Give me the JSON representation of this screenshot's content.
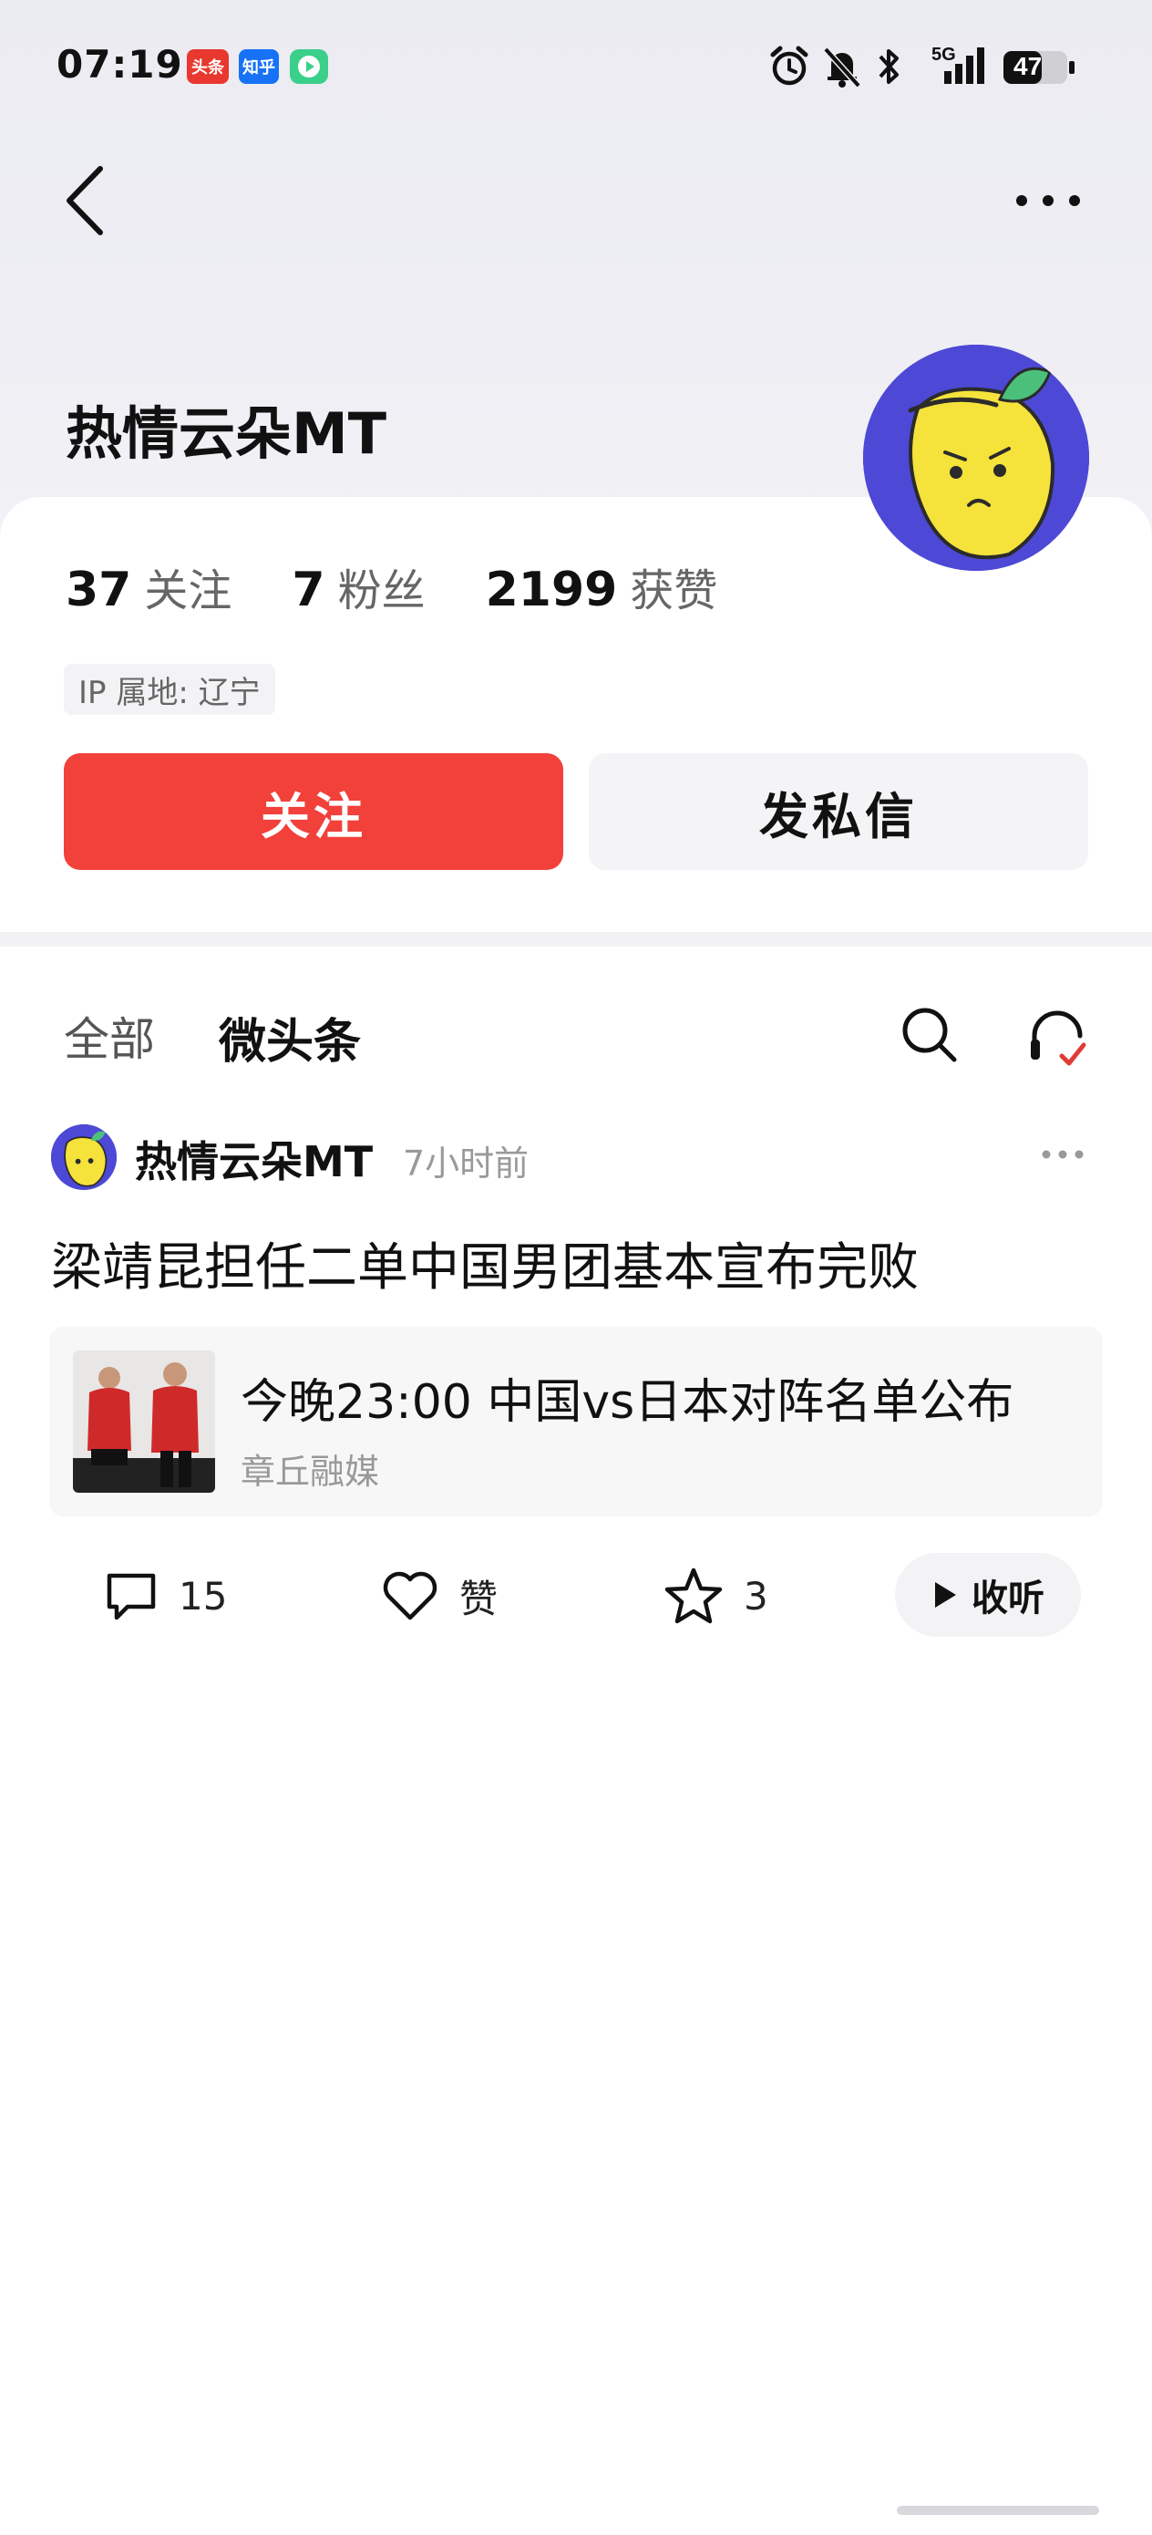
{
  "status_bar": {
    "time": "07:19",
    "apps": [
      "头条",
      "知乎",
      "视频"
    ],
    "network": "5G",
    "battery": "47"
  },
  "profile": {
    "name": "热情云朵MT",
    "stats": [
      {
        "num": "37",
        "label": "关注"
      },
      {
        "num": "7",
        "label": "粉丝"
      },
      {
        "num": "2199",
        "label": "获赞"
      }
    ],
    "ip": "IP 属地: 辽宁",
    "follow_label": "关注",
    "message_label": "发私信"
  },
  "tabs": {
    "all": "全部",
    "weitoutiao": "微头条"
  },
  "post": {
    "author": "热情云朵MT",
    "time": "7小时前",
    "text": "梁靖昆担任二单中国男团基本宣布完败",
    "link": {
      "title": "今晚23:00 中国vs日本对阵名单公布",
      "source": "章丘融媒"
    },
    "actions": {
      "comments": "15",
      "like_label": "赞",
      "favorites": "3",
      "listen_label": "收听"
    }
  },
  "colors": {
    "accent_red": "#f2403b",
    "avatar_purple": "#4d49d6",
    "lemon_yellow": "#f5e23b"
  }
}
